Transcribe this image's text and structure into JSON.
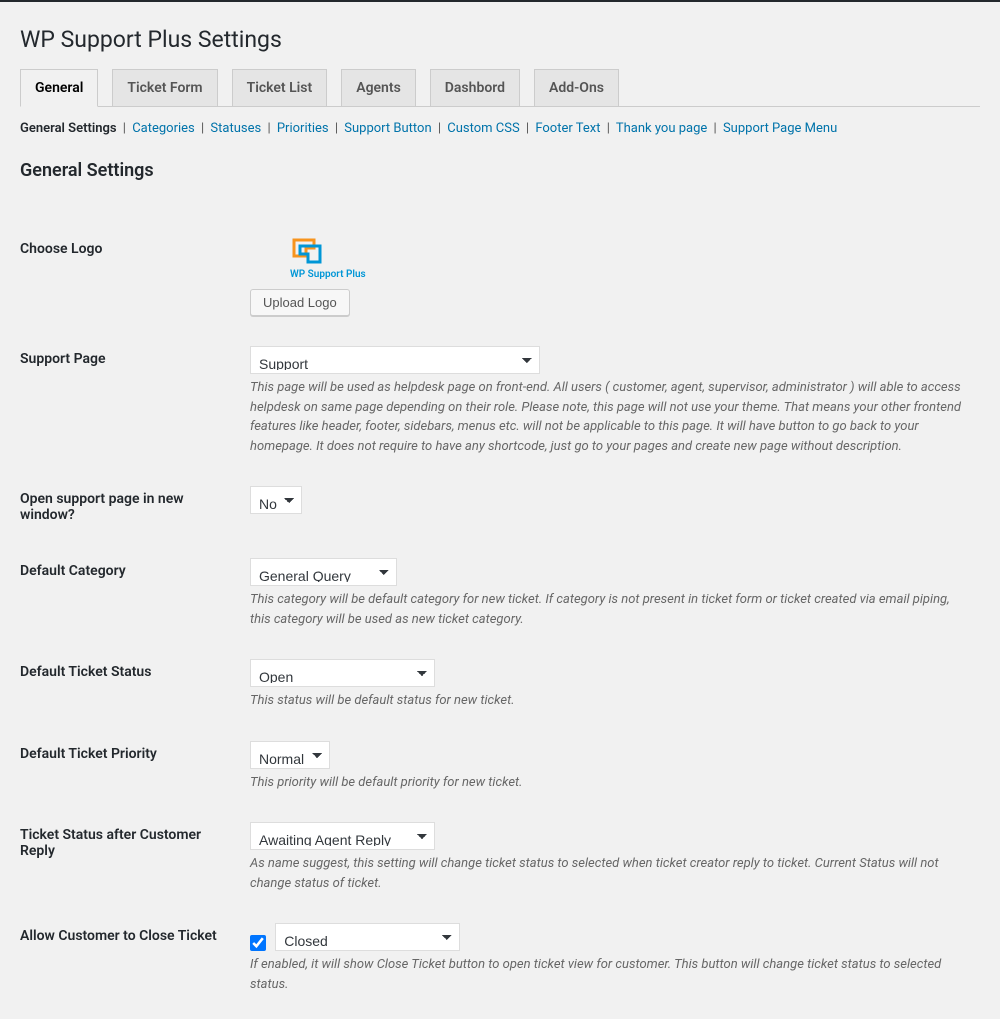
{
  "page_title": "WP Support Plus Settings",
  "tabs": [
    "General",
    "Ticket Form",
    "Ticket List",
    "Agents",
    "Dashbord",
    "Add-Ons"
  ],
  "subnav": [
    "General Settings",
    "Categories",
    "Statuses",
    "Priorities",
    "Support Button",
    "Custom CSS",
    "Footer Text",
    "Thank you page",
    "Support Page Menu"
  ],
  "section_title": "General Settings",
  "logo": {
    "label": "Choose Logo",
    "brand": "WP Support Plus",
    "upload_btn": "Upload Logo"
  },
  "support_page": {
    "label": "Support Page",
    "value": "Support",
    "desc": "This page will be used as helpdesk page on front-end. All users ( customer, agent, supervisor, administrator ) will able to access helpdesk on same page depending on their role. Please note, this page will not use your theme. That means your other frontend features like header, footer, sidebars, menus etc. will not be applicable to this page. It will have button to go back to your homepage. It does not require to have any shortcode, just go to your pages and create new page without description."
  },
  "open_new_window": {
    "label": "Open support page in new window?",
    "value": "No"
  },
  "default_category": {
    "label": "Default Category",
    "value": "General Query",
    "desc": "This category will be default category for new ticket. If category is not present in ticket form or ticket created via email piping, this category will be used as new ticket category."
  },
  "default_status": {
    "label": "Default Ticket Status",
    "value": "Open",
    "desc": "This status will be default status for new ticket."
  },
  "default_priority": {
    "label": "Default Ticket Priority",
    "value": "Normal",
    "desc": "This priority will be default priority for new ticket."
  },
  "status_after_reply": {
    "label": "Ticket Status after Customer Reply",
    "value": "Awaiting Agent Reply",
    "desc": "As name suggest, this setting will change ticket status to selected when ticket creator reply to ticket. Current Status will not change status of ticket."
  },
  "allow_close": {
    "label": "Allow Customer to Close Ticket",
    "value": "Closed",
    "desc": "If enabled, it will show Close Ticket button to open ticket view for customer. This button will change ticket status to selected status."
  }
}
